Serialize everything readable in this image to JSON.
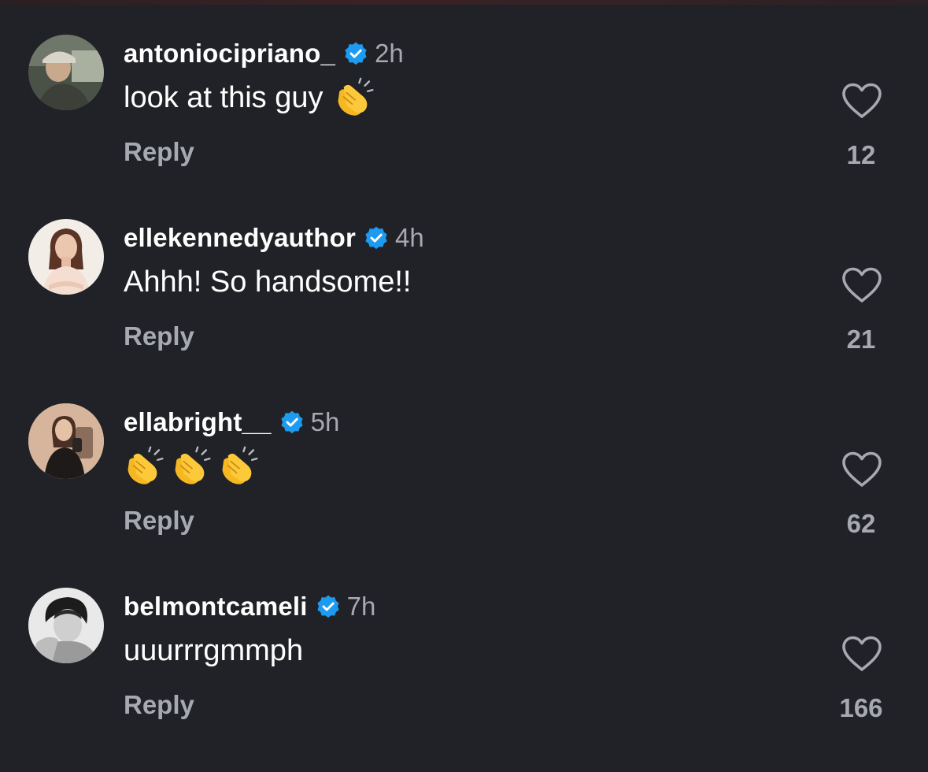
{
  "comments": [
    {
      "username": "antoniocipriano_",
      "time": "2h",
      "text": "look at this guy",
      "claps": 1,
      "reply_label": "Reply",
      "likes": "12",
      "avatar_icon": "avatar-photo"
    },
    {
      "username": "ellekennedyauthor",
      "time": "4h",
      "text": "Ahhh! So handsome!!",
      "claps": 0,
      "reply_label": "Reply",
      "likes": "21",
      "avatar_icon": "avatar-photo"
    },
    {
      "username": "ellabright__",
      "time": "5h",
      "text": "",
      "claps": 3,
      "reply_label": "Reply",
      "likes": "62",
      "avatar_icon": "avatar-photo"
    },
    {
      "username": "belmontcameli",
      "time": "7h",
      "text": "uuurrrgmmph",
      "claps": 0,
      "reply_label": "Reply",
      "likes": "166",
      "avatar_icon": "avatar-photo"
    }
  ],
  "colors": {
    "background": "#212227",
    "primary_text": "#ffffff",
    "secondary_text": "#a6a9b0",
    "verified_badge": "#1d9bf0",
    "heart_outline": "#a6a9b0"
  },
  "icons": {
    "verified": "verified-badge-icon",
    "like": "heart-outline-icon",
    "clap": "clapping-hands-emoji"
  }
}
